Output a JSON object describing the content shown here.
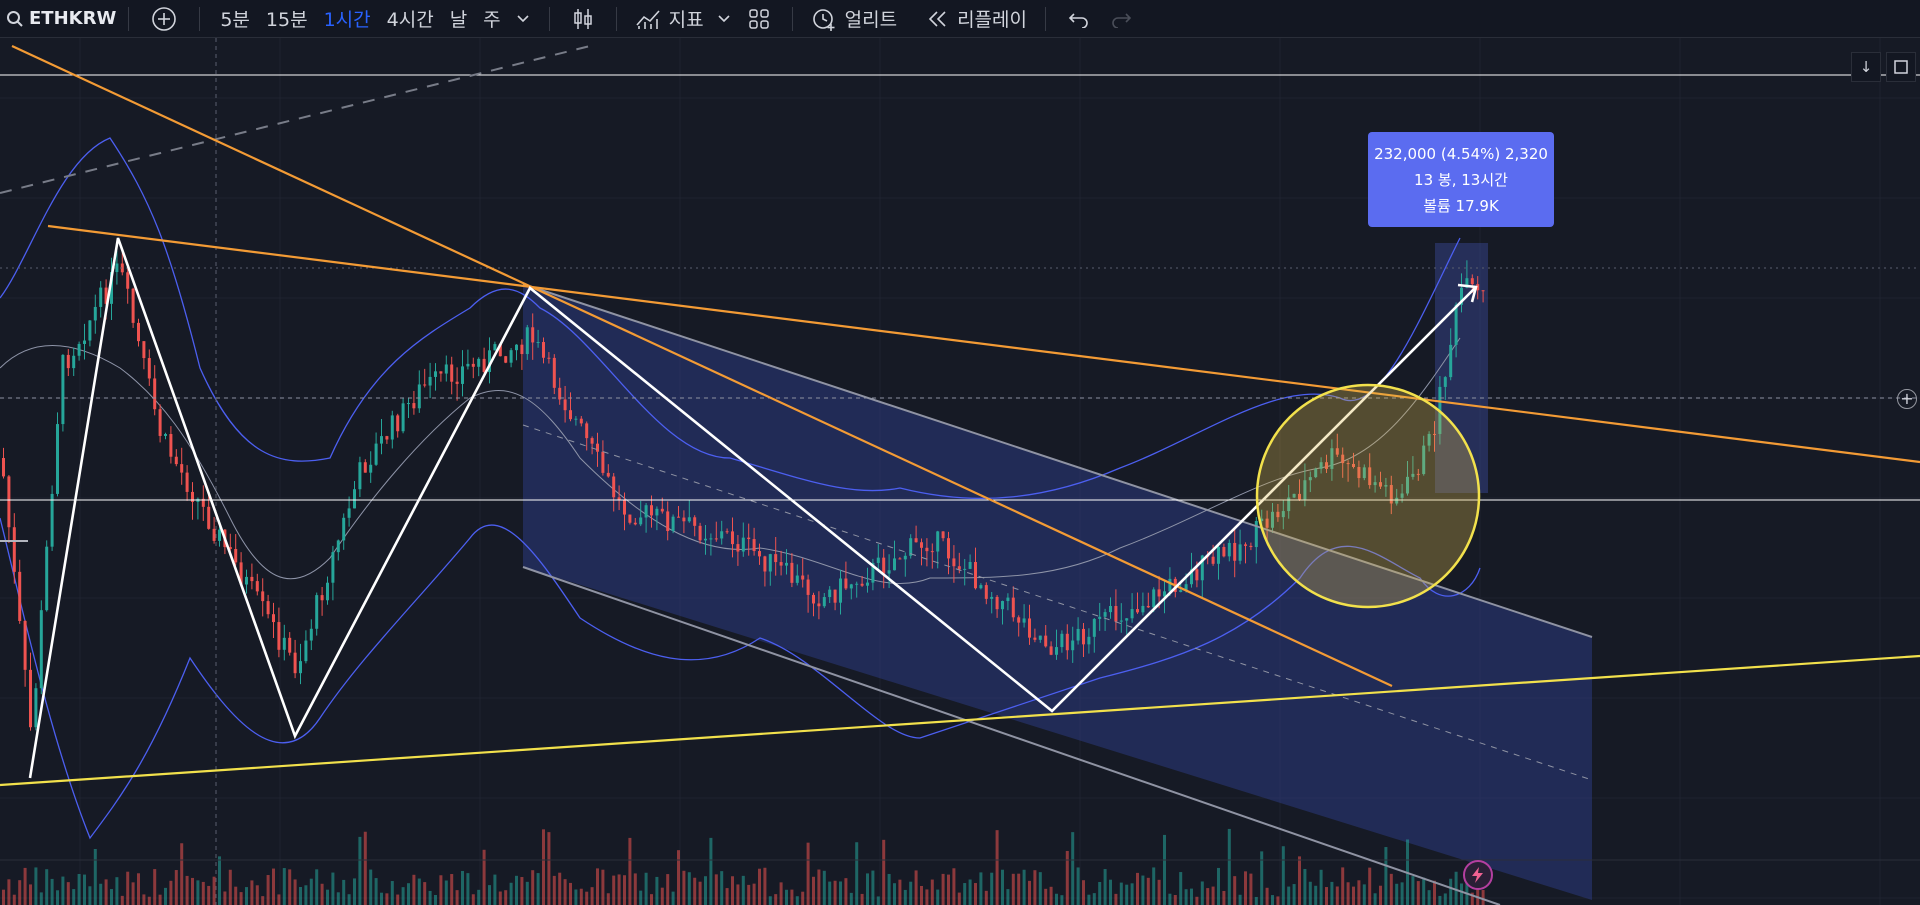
{
  "toolbar": {
    "symbol": "ETHKRW",
    "intervals": [
      "5분",
      "15분",
      "1시간",
      "4시간",
      "날",
      "주"
    ],
    "active_interval": "1시간",
    "indicators_label": "지표",
    "alert_label": "얼리트",
    "replay_label": "리플레이"
  },
  "measure_tooltip": {
    "line1": "232,000 (4.54%) 2,320",
    "line2": "13 봉, 13시간",
    "line3": "볼륨 17.9K"
  },
  "colors": {
    "background": "#161a25",
    "up_candle": "#26a69a",
    "down_candle": "#ef5350",
    "bollinger": "#4c5ff0",
    "orange_trend": "#f39b35",
    "yellow_trend": "#f2e14c",
    "channel_fill": "#2b3a80",
    "accent_active": "#2962ff",
    "tooltip": "#5b6cf0"
  },
  "icons": [
    "search-icon",
    "add-symbol-icon",
    "chevron-down-icon",
    "candle-style-icon",
    "indicators-icon",
    "layout-grid-icon",
    "alert-clock-icon",
    "replay-icon",
    "undo-icon",
    "redo-icon",
    "scroll-down-icon",
    "fullscreen-icon",
    "crosshair-plus-icon",
    "lightning-icon"
  ]
}
